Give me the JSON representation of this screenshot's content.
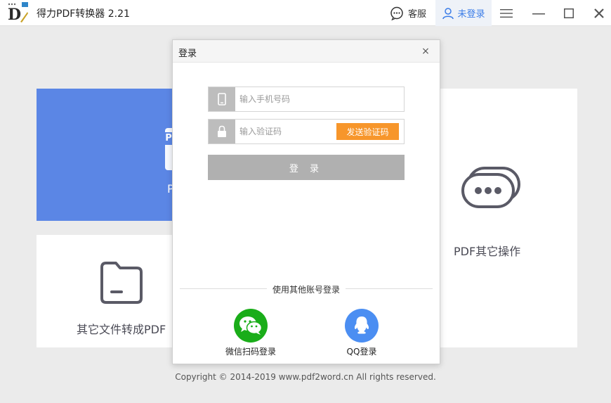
{
  "app": {
    "title": "得力PDF转换器 2.21"
  },
  "titlebar": {
    "service_label": "客服",
    "user_label": "未登录",
    "accent_color": "#3b7de8"
  },
  "cards": {
    "blue_card_text": "P",
    "other_files_label": "其它文件转成PDF",
    "pdf_ops_label": "PDF其它操作"
  },
  "login_dialog": {
    "title": "登录",
    "close_label": "×",
    "phone_placeholder": "输入手机号码",
    "code_placeholder": "输入验证码",
    "send_code_label": "发送验证码",
    "login_label": "登 录",
    "other_login_label": "使用其他账号登录",
    "wechat_label": "微信扫码登录",
    "qq_label": "QQ登录",
    "colors": {
      "send_code": "#f7962b",
      "wechat": "#1aad19",
      "qq": "#4b8ef2",
      "login_disabled": "#b0b0b0"
    }
  },
  "footer": {
    "copyright": "Copyright © 2014-2019  www.pdf2word.cn  All rights reserved."
  },
  "icons": [
    "app-logo",
    "chat-icon",
    "user-icon",
    "menu-icon",
    "minimize-icon",
    "maximize-icon",
    "close-icon",
    "folder-icon",
    "chat-bubbles-icon",
    "phone-icon",
    "lock-icon",
    "wechat-icon",
    "qq-icon"
  ]
}
